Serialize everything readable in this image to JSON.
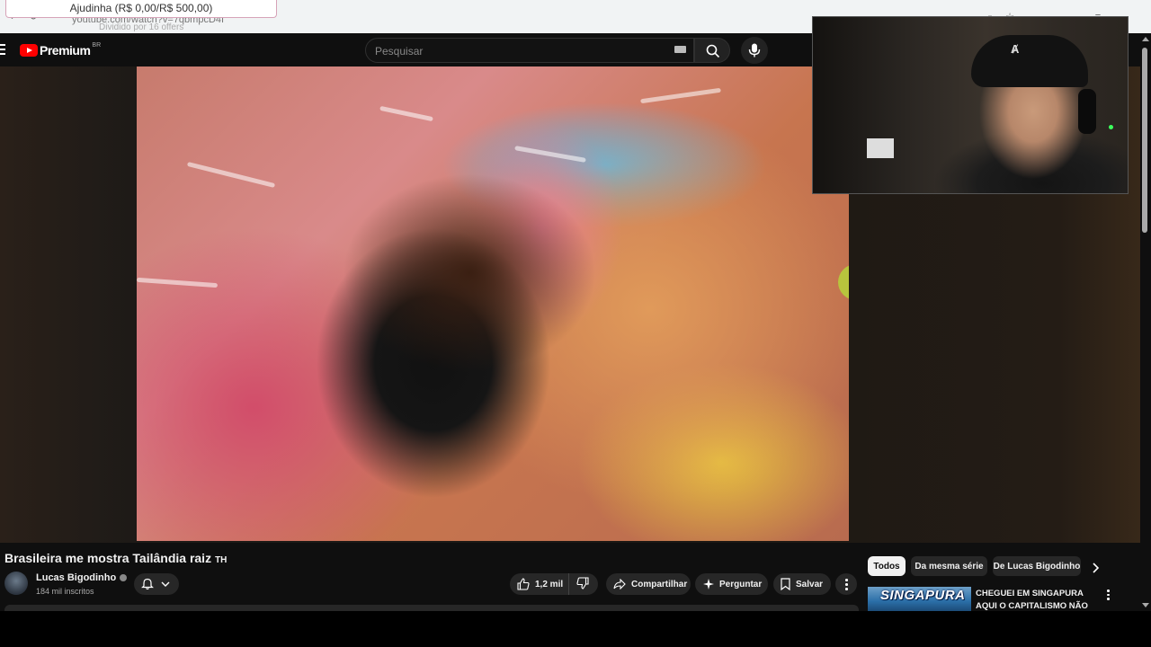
{
  "browser": {
    "url": "youtube.com/watch?v=7qbmpcD4I",
    "address_subtitle": "Dividido por 16 offers",
    "donation_label": "Ajudinha (R$ 0,00/R$ 500,00)"
  },
  "header": {
    "logo_text": "Premium",
    "region": "BR",
    "search_placeholder": "Pesquisar"
  },
  "video": {
    "title": "Brasileira me mostra Tailândia raiz",
    "flag": "TH",
    "channel": "Lucas Bigodinho",
    "subscribers": "184 mil inscritos",
    "likes": "1,2 mil"
  },
  "actions": {
    "share": "Compartilhar",
    "ask": "Perguntar",
    "save": "Salvar"
  },
  "sidebar": {
    "chips": [
      "Todos",
      "Da mesma série",
      "De Lucas Bigodinho"
    ],
    "recommendation": {
      "thumb_text": "SINGAPURA",
      "title": "CHEGUEI EM SINGAPURA AQUI O CAPITALISMO NÃO TEM ..."
    }
  },
  "webcam": {
    "cap_logo": "Ⱥ"
  },
  "colors": {
    "accent": "#ff0000",
    "background": "#0f0f0f",
    "chip_active": "#f1f1f1",
    "pill": "#272727"
  }
}
